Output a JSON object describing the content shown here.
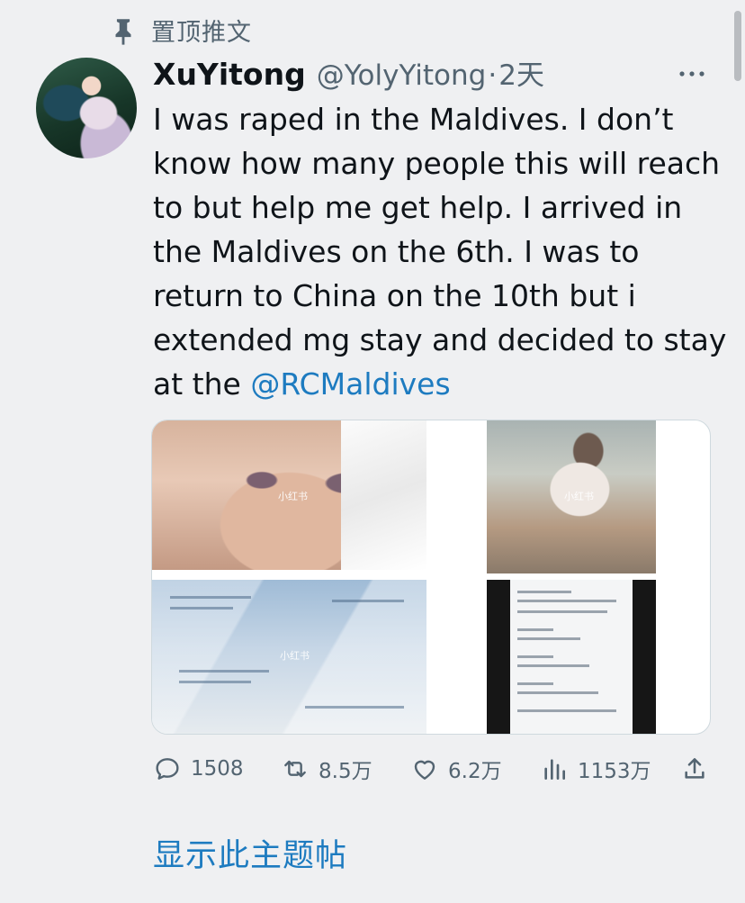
{
  "pinned": {
    "label": "置顶推文"
  },
  "tweet": {
    "author_name": "XuYitong",
    "handle": "@YolyYitong",
    "separator": "·",
    "time": "2天",
    "text": "I was raped in the Maldives. I don’t know how many people this will reach to but help me get help. I arrived in the Maldives on the 6th. I was to return to China on the 10th but i extended mg stay and decided to stay at the ",
    "mention": "@RCMaldives",
    "media_watermarks": [
      "小红书",
      "小红书",
      "小红书"
    ]
  },
  "actions": {
    "replies": "1508",
    "retweets": "8.5万",
    "likes": "6.2万",
    "views": "1153万"
  },
  "show_thread": "显示此主题帖",
  "colors": {
    "link": "#1d7bc0",
    "secondary_text": "#536471",
    "background": "#eff0f2"
  }
}
